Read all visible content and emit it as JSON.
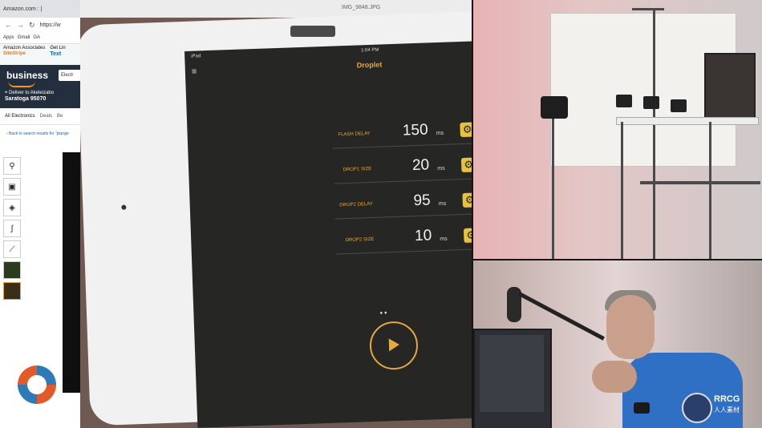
{
  "browser": {
    "tab_title": "Amazon.com : |",
    "url": "https://w",
    "bookmarks": [
      "Apps",
      "Gmail",
      "GA"
    ],
    "associates_line1": "Amazon Associates",
    "associates_line2": "SiteStripe",
    "get_link_line1": "Get Lin",
    "get_link_line2": "Text",
    "business_logo": "business",
    "deliver_line1": "Deliver to Akeleizabo",
    "deliver_line2": "Saratoga 95070",
    "dept_button": "Electr",
    "categories": [
      "All Electronics",
      "Deals",
      "Be"
    ],
    "back_link": "‹ Back to search results for \"plunge"
  },
  "ipad": {
    "filename": "IMG_9848.JPG",
    "status_left": "iPad",
    "status_time": "1:04 PM",
    "app_title": "Droplet",
    "rows": [
      {
        "label": "FLASH DELAY",
        "value": "150",
        "unit": "ms"
      },
      {
        "label": "DROP1 SIZE",
        "value": "20",
        "unit": "ms"
      },
      {
        "label": "DROP2 DELAY",
        "value": "95",
        "unit": "ms"
      },
      {
        "label": "DROP2 SIZE",
        "value": "10",
        "unit": "ms"
      }
    ],
    "page_dots": "••"
  },
  "badge": {
    "name": "RRCG",
    "sub": "人人素材"
  },
  "colors": {
    "accent_orange": "#e8a83a",
    "gear_yellow": "#e8c23a",
    "amazon_navy": "#232f3e",
    "amazon_orange": "#ff9900"
  }
}
